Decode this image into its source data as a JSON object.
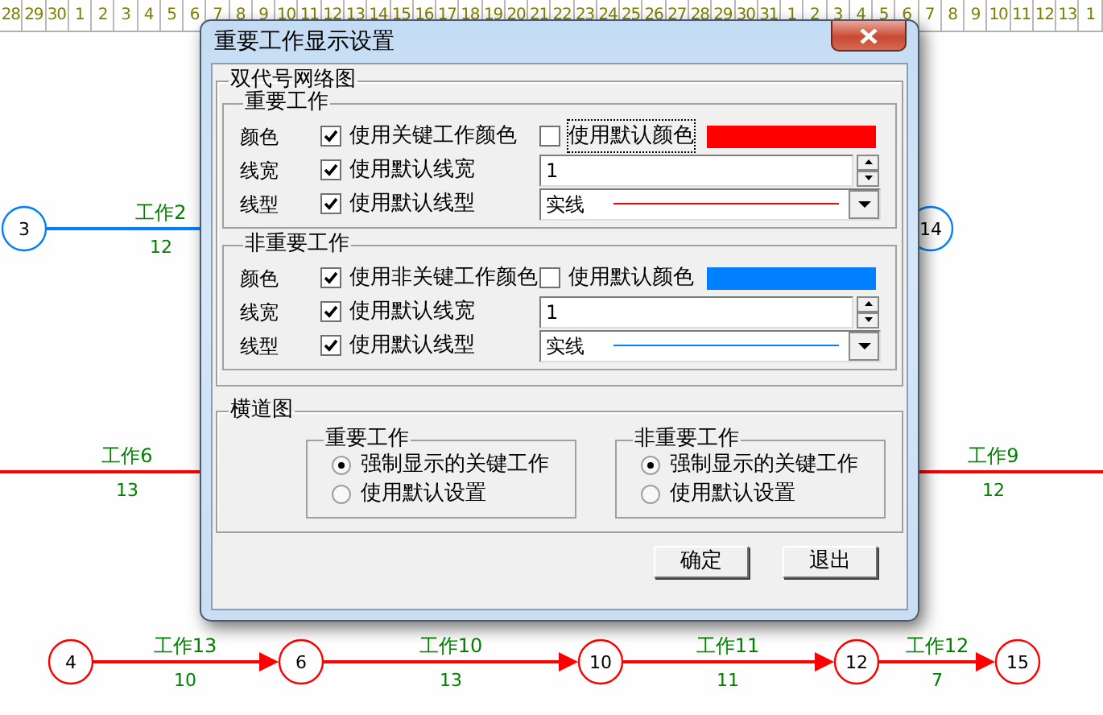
{
  "timescale": {
    "days": [
      "28",
      "29",
      "30",
      "1",
      "2",
      "3",
      "4",
      "5",
      "6",
      "7",
      "8",
      "9",
      "10",
      "11",
      "12",
      "13",
      "14",
      "15",
      "16",
      "17",
      "18",
      "19",
      "20",
      "21",
      "22",
      "23",
      "24",
      "25",
      "26",
      "27",
      "28",
      "29",
      "30",
      "31",
      "1",
      "2",
      "3",
      "4",
      "5",
      "6",
      "7",
      "8",
      "9",
      "10",
      "11",
      "12",
      "13",
      "1"
    ]
  },
  "network": {
    "nodes": [
      {
        "label": "3",
        "color": "#0080ff"
      },
      {
        "label": "14",
        "color": "#0080ff"
      },
      {
        "label": "4",
        "color": "#ff0000"
      },
      {
        "label": "6",
        "color": "#ff0000"
      },
      {
        "label": "10",
        "color": "#ff0000"
      },
      {
        "label": "12",
        "color": "#ff0000"
      },
      {
        "label": "15",
        "color": "#ff0000"
      }
    ],
    "activities": [
      {
        "name": "工作2",
        "duration": "12",
        "color": "#0080ff"
      },
      {
        "name": "工作6",
        "duration": "13",
        "color": "#ff0000"
      },
      {
        "name": "工作9",
        "duration": "12",
        "color": "#ff0000"
      },
      {
        "name": "工作13",
        "duration": "10",
        "color": "#ff0000"
      },
      {
        "name": "工作10",
        "duration": "13",
        "color": "#ff0000"
      },
      {
        "name": "工作11",
        "duration": "11",
        "color": "#ff0000"
      },
      {
        "name": "工作12",
        "duration": "7",
        "color": "#ff0000"
      }
    ]
  },
  "dialog": {
    "title": "重要工作显示设置",
    "network_group": {
      "title": "双代号网络图",
      "sections": [
        {
          "title": "重要工作",
          "color": "#ff0000",
          "rows": [
            {
              "kind": "color",
              "label": "颜色",
              "option": {
                "label": "使用关键工作颜色",
                "checked": true
              },
              "default_option": {
                "label": "使用默认颜色",
                "checked": false,
                "focused": true
              }
            },
            {
              "kind": "width",
              "label": "线宽",
              "option": {
                "label": "使用默认线宽",
                "checked": true
              },
              "value": "1"
            },
            {
              "kind": "style",
              "label": "线型",
              "option": {
                "label": "使用默认线型",
                "checked": true
              },
              "value": "实线"
            }
          ]
        },
        {
          "title": "非重要工作",
          "color": "#0080ff",
          "rows": [
            {
              "kind": "color",
              "label": "颜色",
              "option": {
                "label": "使用非关键工作颜色",
                "checked": true
              },
              "default_option": {
                "label": "使用默认颜色",
                "checked": false,
                "focused": false
              }
            },
            {
              "kind": "width",
              "label": "线宽",
              "option": {
                "label": "使用默认线宽",
                "checked": true
              },
              "value": "1"
            },
            {
              "kind": "style",
              "label": "线型",
              "option": {
                "label": "使用默认线型",
                "checked": true
              },
              "value": "实线"
            }
          ]
        }
      ]
    },
    "gantt_group": {
      "title": "横道图",
      "groups": [
        {
          "title": "重要工作",
          "options": [
            {
              "label": "强制显示的关键工作",
              "selected": true
            },
            {
              "label": "使用默认设置",
              "selected": false
            }
          ]
        },
        {
          "title": "非重要工作",
          "options": [
            {
              "label": "强制显示的关键工作",
              "selected": true
            },
            {
              "label": "使用默认设置",
              "selected": false
            }
          ]
        }
      ]
    },
    "buttons": [
      "确定",
      "退出"
    ]
  }
}
